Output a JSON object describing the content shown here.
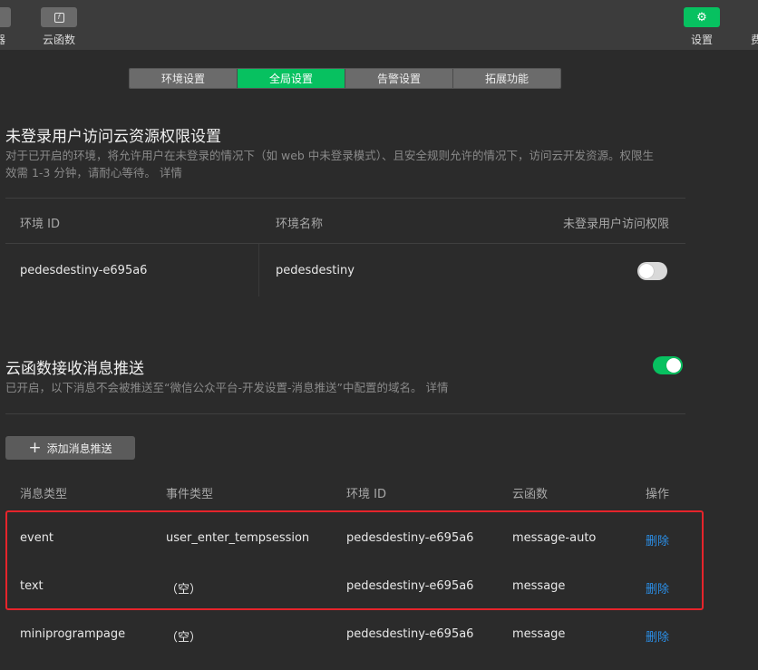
{
  "toolbar": {
    "left_partial_label": "器",
    "cloud_func_label": "云函数",
    "settings_label": "设置",
    "right_partial_label": "费",
    "cloud_func_icon": "function-icon",
    "settings_icon": "gear-icon"
  },
  "tabs": [
    {
      "label": "环境设置",
      "active": false
    },
    {
      "label": "全局设置",
      "active": true
    },
    {
      "label": "告警设置",
      "active": false
    },
    {
      "label": "拓展功能",
      "active": false
    }
  ],
  "unauth": {
    "title": "未登录用户访问云资源权限设置",
    "desc_line1": "对于已开启的环境，将允许用户在未登录的情况下（如 web 中未登录模式）、且安全规则允许的情况下，访问云开发资源。权限生",
    "desc_line2": "效需 1-3 分钟，请耐心等待。 详情",
    "columns": [
      "环境 ID",
      "环境名称",
      "未登录用户访问权限"
    ],
    "row": {
      "env_id": "pedesdestiny-e695a6",
      "env_name": "pedesdestiny",
      "enabled": false
    }
  },
  "push": {
    "title": "云函数接收消息推送",
    "enabled": true,
    "desc": "已开启，以下消息不会被推送至“微信公众平台-开发设置-消息推送”中配置的域名。 详情",
    "add_label": "添加消息推送",
    "columns": [
      "消息类型",
      "事件类型",
      "环境 ID",
      "云函数",
      "操作"
    ],
    "rows": [
      {
        "msg_type": "event",
        "event_type": "user_enter_tempsession",
        "env_id": "pedesdestiny-e695a6",
        "func": "message-auto",
        "action": "删除"
      },
      {
        "msg_type": "text",
        "event_type": "（空）",
        "env_id": "pedesdestiny-e695a6",
        "func": "message",
        "action": "删除"
      },
      {
        "msg_type": "miniprogrampage",
        "event_type": "（空）",
        "env_id": "pedesdestiny-e695a6",
        "func": "message",
        "action": "删除"
      }
    ]
  },
  "colors": {
    "accent_green": "#07c160",
    "link_blue": "#2b8ee6",
    "highlight_red": "#e6242b"
  }
}
